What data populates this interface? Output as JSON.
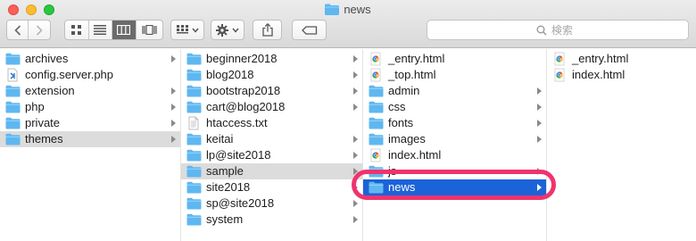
{
  "window": {
    "title": "news"
  },
  "toolbar": {
    "search_placeholder": "検索"
  },
  "columns": [
    {
      "items": [
        {
          "label": "archives",
          "type": "folder"
        },
        {
          "label": "config.server.php",
          "type": "php"
        },
        {
          "label": "extension",
          "type": "folder"
        },
        {
          "label": "php",
          "type": "folder"
        },
        {
          "label": "private",
          "type": "folder"
        },
        {
          "label": "themes",
          "type": "folder",
          "selected": "gray"
        }
      ]
    },
    {
      "items": [
        {
          "label": "beginner2018",
          "type": "folder"
        },
        {
          "label": "blog2018",
          "type": "folder"
        },
        {
          "label": "bootstrap2018",
          "type": "folder"
        },
        {
          "label": "cart@blog2018",
          "type": "folder"
        },
        {
          "label": "htaccess.txt",
          "type": "text"
        },
        {
          "label": "keitai",
          "type": "folder"
        },
        {
          "label": "lp@site2018",
          "type": "folder"
        },
        {
          "label": "sample",
          "type": "folder",
          "selected": "gray"
        },
        {
          "label": "site2018",
          "type": "folder"
        },
        {
          "label": "sp@site2018",
          "type": "folder"
        },
        {
          "label": "system",
          "type": "folder"
        }
      ]
    },
    {
      "items": [
        {
          "label": "_entry.html",
          "type": "html"
        },
        {
          "label": "_top.html",
          "type": "html"
        },
        {
          "label": "admin",
          "type": "folder"
        },
        {
          "label": "css",
          "type": "folder"
        },
        {
          "label": "fonts",
          "type": "folder"
        },
        {
          "label": "images",
          "type": "folder"
        },
        {
          "label": "index.html",
          "type": "html"
        },
        {
          "label": "js",
          "type": "folder"
        },
        {
          "label": "news",
          "type": "folder",
          "selected": "blue"
        }
      ]
    },
    {
      "items": [
        {
          "label": "_entry.html",
          "type": "html"
        },
        {
          "label": "index.html",
          "type": "html"
        }
      ]
    }
  ],
  "colors": {
    "selection_blue": "#1b63d8",
    "highlight_ring": "#f0336f",
    "folder": "#5fb7f0"
  }
}
